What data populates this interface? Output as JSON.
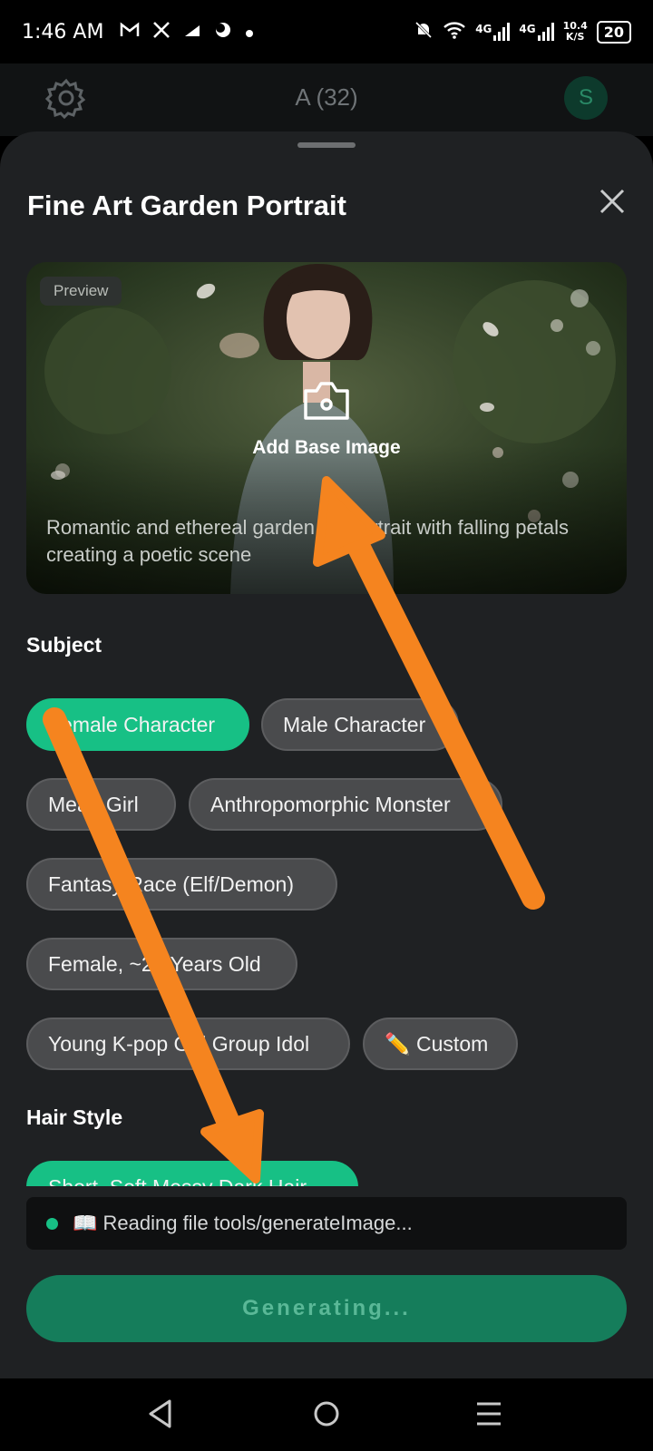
{
  "status_bar": {
    "time": "1:46 AM",
    "network_1": "4G",
    "network_2": "4G",
    "speed_value": "10.4",
    "speed_unit": "K/S",
    "battery": "20"
  },
  "app_header": {
    "title": "A (32)",
    "avatar_letter": "S"
  },
  "sheet": {
    "title": "Fine Art Garden Portrait",
    "preview": {
      "tag": "Preview",
      "add_base_label": "Add Base Image",
      "description": "Romantic and ethereal garden art portrait with falling petals creating a poetic scene"
    },
    "subject": {
      "label": "Subject",
      "options": [
        "Female Character",
        "Male Character",
        "Mean Girl",
        "Anthropomorphic Monster",
        "Fantasy Race (Elf/Demon)",
        "Female, ~20 Years Old",
        "Young K-pop Girl Group Idol",
        "✏️ Custom"
      ],
      "selected": "Female Character"
    },
    "hair_style": {
      "label": "Hair Style",
      "selected": "Short, Soft Messy Dark Hair"
    },
    "progress_text": "📖 Reading file tools/generateImage...",
    "generate_button": "Generating..."
  },
  "colors": {
    "accent": "#17c085",
    "annotation_arrow": "#f5841f"
  }
}
